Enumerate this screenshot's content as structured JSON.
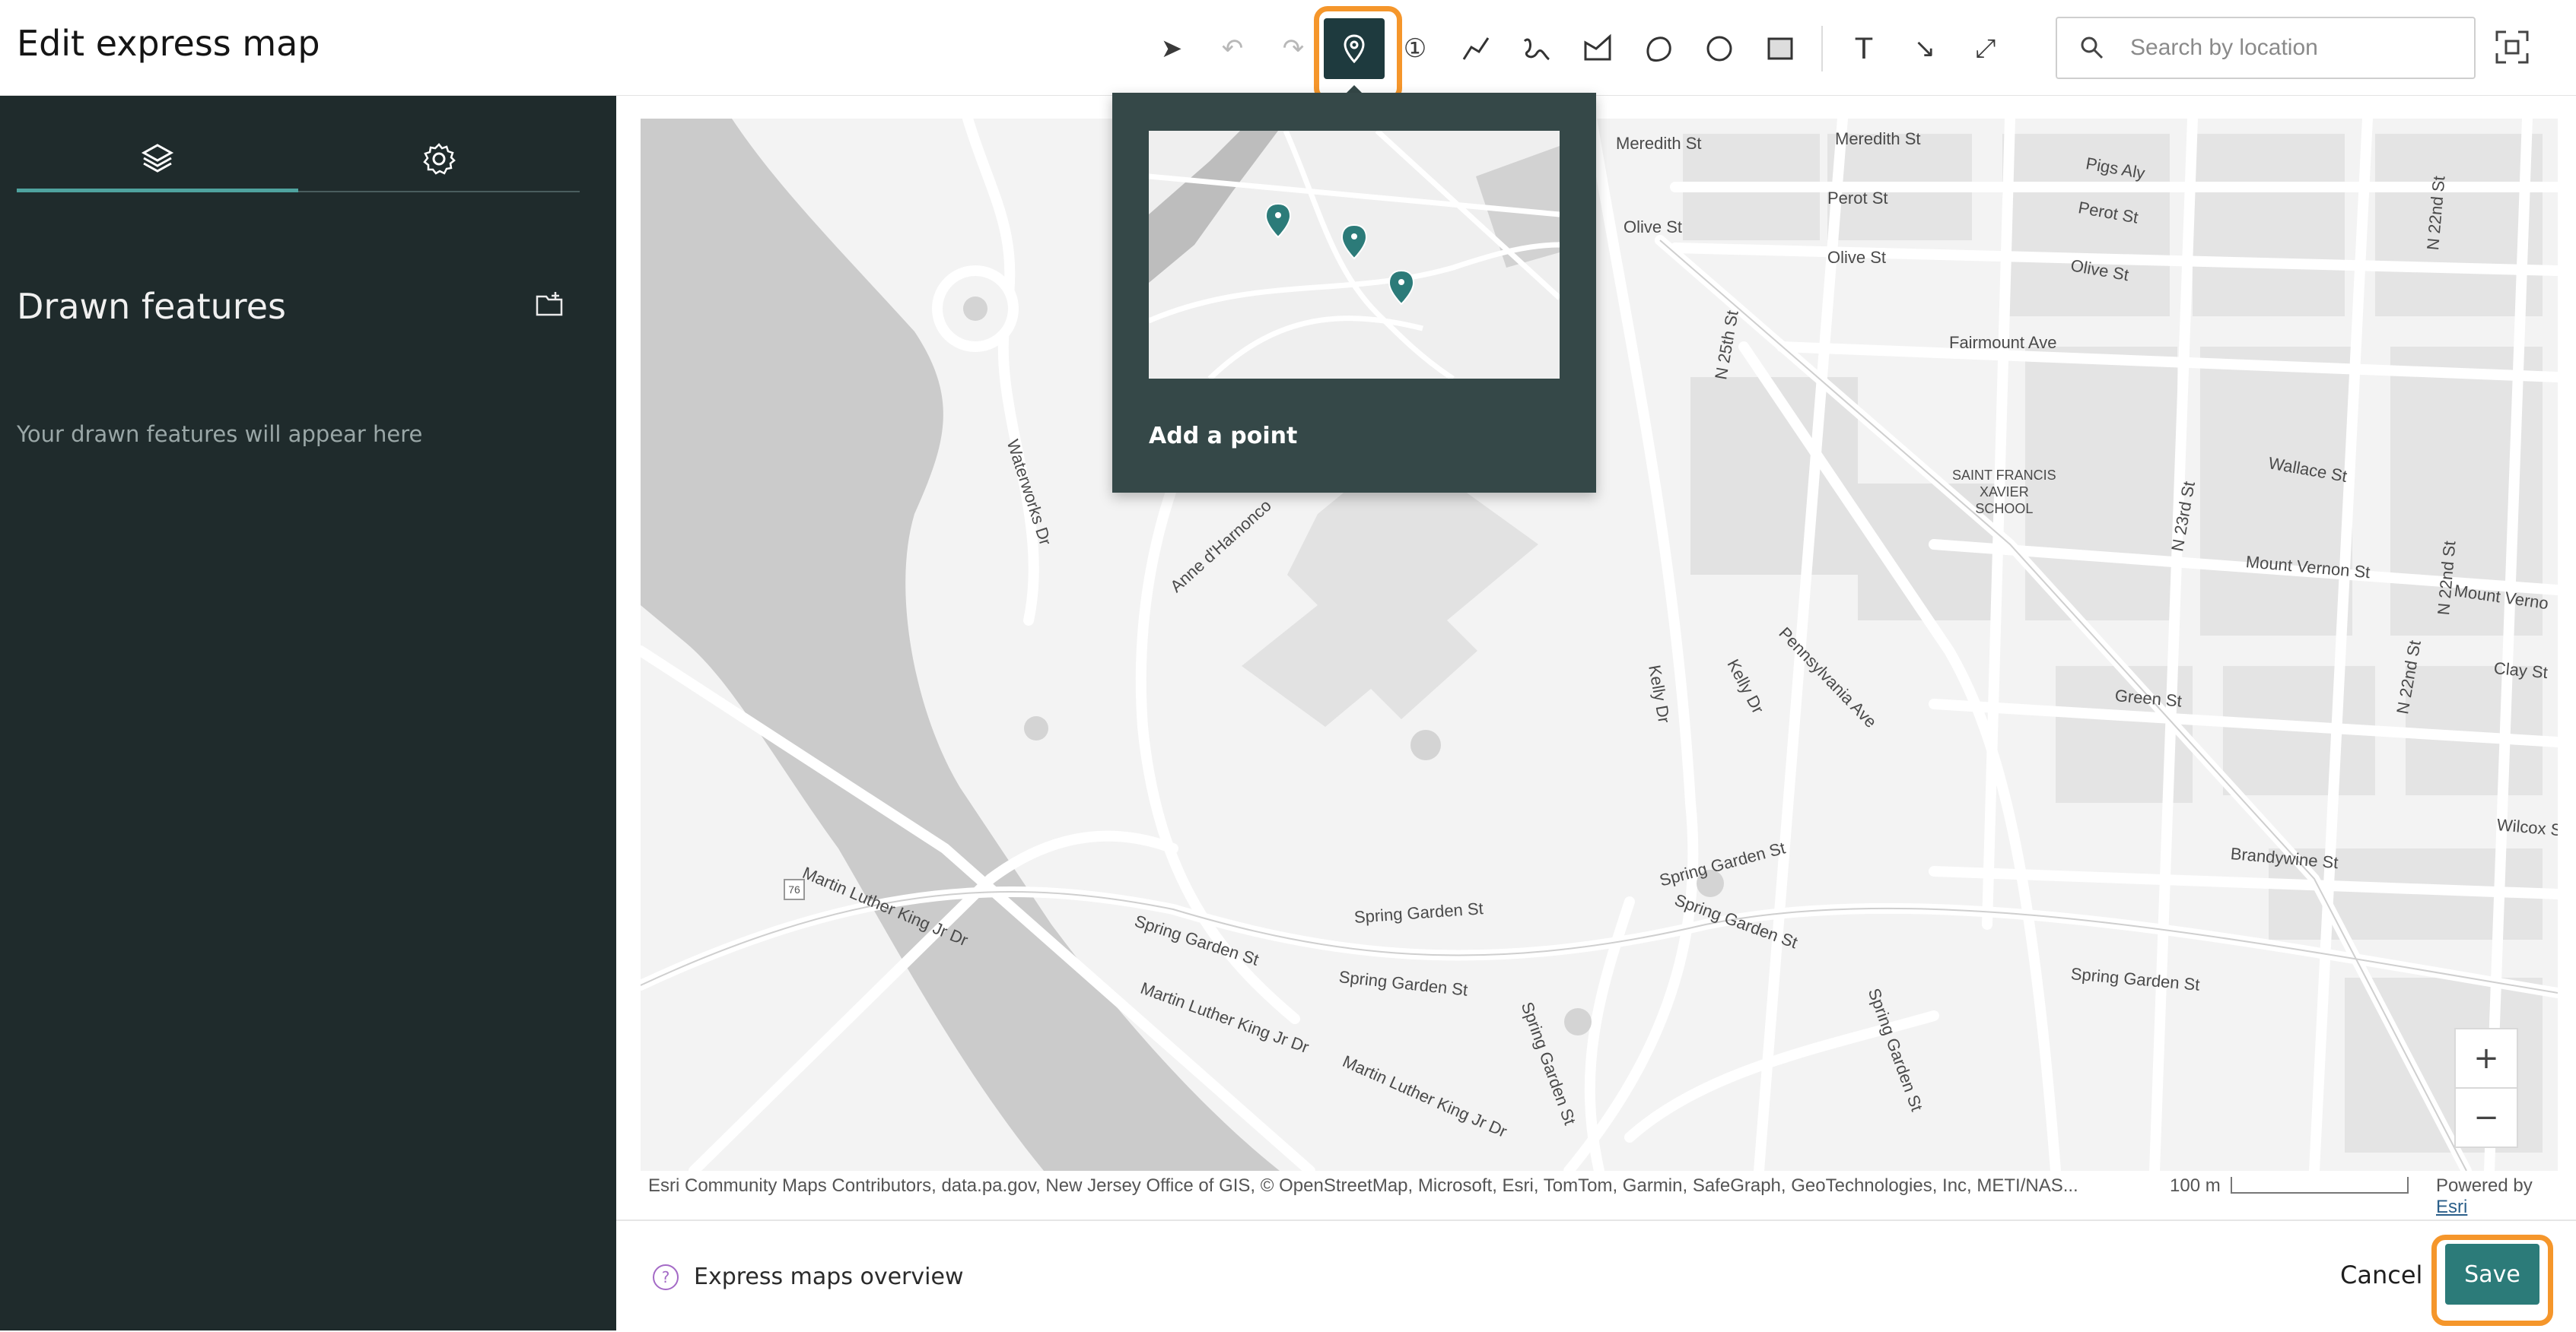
{
  "header": {
    "title": "Edit express map",
    "toolbar": [
      {
        "name": "select-tool",
        "icon": "pointer-icon",
        "glyph": "➤",
        "disabled": false
      },
      {
        "name": "undo-tool",
        "icon": "undo-icon",
        "glyph": "↶",
        "disabled": true
      },
      {
        "name": "redo-tool",
        "icon": "redo-icon",
        "glyph": "↷",
        "disabled": true
      },
      {
        "name": "point-tool",
        "icon": "map-pin-icon",
        "glyph": "📍",
        "active": true
      },
      {
        "name": "numbered-point-tool",
        "icon": "numbered-marker-icon",
        "glyph": "①"
      },
      {
        "name": "line-tool",
        "icon": "polyline-icon",
        "glyph": "╱"
      },
      {
        "name": "freehand-line-tool",
        "icon": "freehand-icon",
        "glyph": "∿"
      },
      {
        "name": "polygon-tool",
        "icon": "polygon-icon",
        "glyph": "◭"
      },
      {
        "name": "freehand-polygon-tool",
        "icon": "freehand-polygon-icon",
        "glyph": "⬯"
      },
      {
        "name": "circle-tool",
        "icon": "circle-icon",
        "glyph": "◯"
      },
      {
        "name": "rectangle-tool",
        "icon": "rectangle-icon",
        "glyph": "▢"
      },
      {
        "name": "text-tool",
        "icon": "text-icon",
        "glyph": "T"
      },
      {
        "name": "arrow-tool",
        "icon": "arrow-icon",
        "glyph": "↘"
      },
      {
        "name": "double-arrow-tool",
        "icon": "double-arrow-icon",
        "glyph": "⤢"
      }
    ],
    "search": {
      "placeholder": "Search by location",
      "value": ""
    }
  },
  "sidebar": {
    "tabs": [
      {
        "name": "layers",
        "icon": "layers-icon"
      },
      {
        "name": "settings",
        "icon": "gear-icon"
      }
    ],
    "panel_title": "Drawn features",
    "empty_message": "Your drawn features will appear here"
  },
  "tooltip": {
    "label": "Add a point"
  },
  "map": {
    "streets": [
      "Meredith St",
      "Meredith St",
      "Pigs Aly",
      "Perot St",
      "Perot St",
      "Olive St",
      "Olive St",
      "Olive St",
      "Fairmount Ave",
      "N 25th St",
      "Wallace St",
      "N 23rd St",
      "Mount Vernon St",
      "Mount Verno",
      "N 22nd St",
      "N 22nd St",
      "Clay St",
      "N 22nd St",
      "Waterworks Dr",
      "Anne d'Harnonco",
      "Kelly Dr",
      "Kelly Dr",
      "Pennsylvania Ave",
      "Green St",
      "Wilcox St",
      "Brandywine St",
      "Spring Garden St",
      "Spring Garden St",
      "Spring Garden St",
      "Spring Garden St",
      "Spring Garden St",
      "Spring Garden St",
      "Spring Garden St",
      "Spring Garden St",
      "Martin Luther King Jr Dr",
      "Martin Luther King Jr Dr",
      "Martin Luther King Jr Dr"
    ],
    "poi": "SAINT FRANCIS\nXAVIER\nSCHOOL",
    "route_shield": "76",
    "attribution": "Esri Community Maps Contributors, data.pa.gov, New Jersey Office of GIS, © OpenStreetMap, Microsoft, Esri, TomTom, Garmin, SafeGraph, GeoTechnologies, Inc, METI/NAS...",
    "scale_label": "100 m",
    "powered_by": "Powered by",
    "powered_link": "Esri",
    "zoom_in": "+",
    "zoom_out": "−"
  },
  "footer": {
    "help_text": "Express maps overview",
    "help_icon": "?",
    "cancel_label": "Cancel",
    "save_label": "Save"
  }
}
